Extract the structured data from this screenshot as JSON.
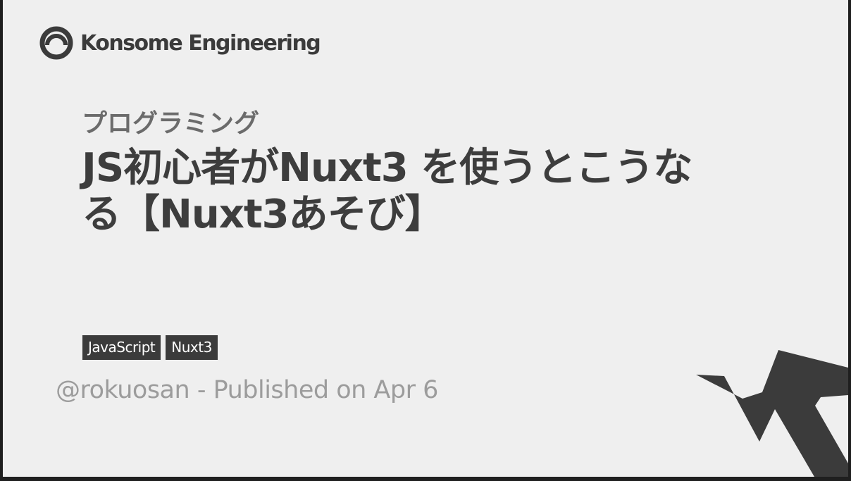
{
  "brand": {
    "logo_icon": "konsome-logo-icon",
    "name": "Konsome Engineering"
  },
  "post": {
    "category": "プログラミング",
    "title": "JS初心者がNuxt3 を使うとこうなる【Nuxt3あそび】",
    "tags": [
      "JavaScript",
      "Nuxt3"
    ],
    "author": "@rokuosan",
    "separator": " - ",
    "published": "Published on Apr 6"
  },
  "colors": {
    "background": "#efefef",
    "frame": "#1f1f1f",
    "text_dark": "#3d3d3d",
    "text_muted": "#9c9c9c",
    "tag_bg": "#3b3b3b",
    "tag_text": "#ffffff"
  },
  "decoration_icon": "zigzag-shape-icon"
}
